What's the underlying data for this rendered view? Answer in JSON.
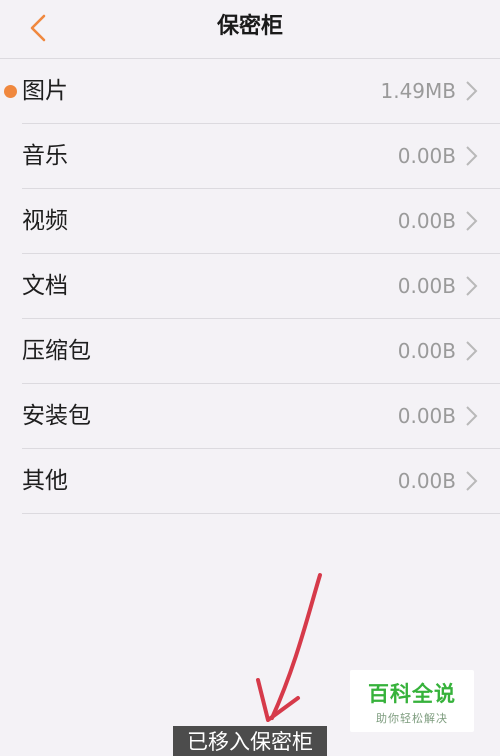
{
  "header": {
    "title": "保密柜",
    "back_icon": "chevron-left-icon",
    "accent_color": "#f0883e"
  },
  "categories": [
    {
      "label": "图片",
      "size": "1.49MB",
      "has_dot": true
    },
    {
      "label": "音乐",
      "size": "0.00B",
      "has_dot": false
    },
    {
      "label": "视频",
      "size": "0.00B",
      "has_dot": false
    },
    {
      "label": "文档",
      "size": "0.00B",
      "has_dot": false
    },
    {
      "label": "压缩包",
      "size": "0.00B",
      "has_dot": false
    },
    {
      "label": "安装包",
      "size": "0.00B",
      "has_dot": false
    },
    {
      "label": "其他",
      "size": "0.00B",
      "has_dot": false
    }
  ],
  "toast": {
    "text": "已移入保密柜"
  },
  "watermark": {
    "title": "百科全说",
    "subtitle": "助你轻松解决"
  },
  "annotation": {
    "arrow_color": "#d63a4a"
  }
}
